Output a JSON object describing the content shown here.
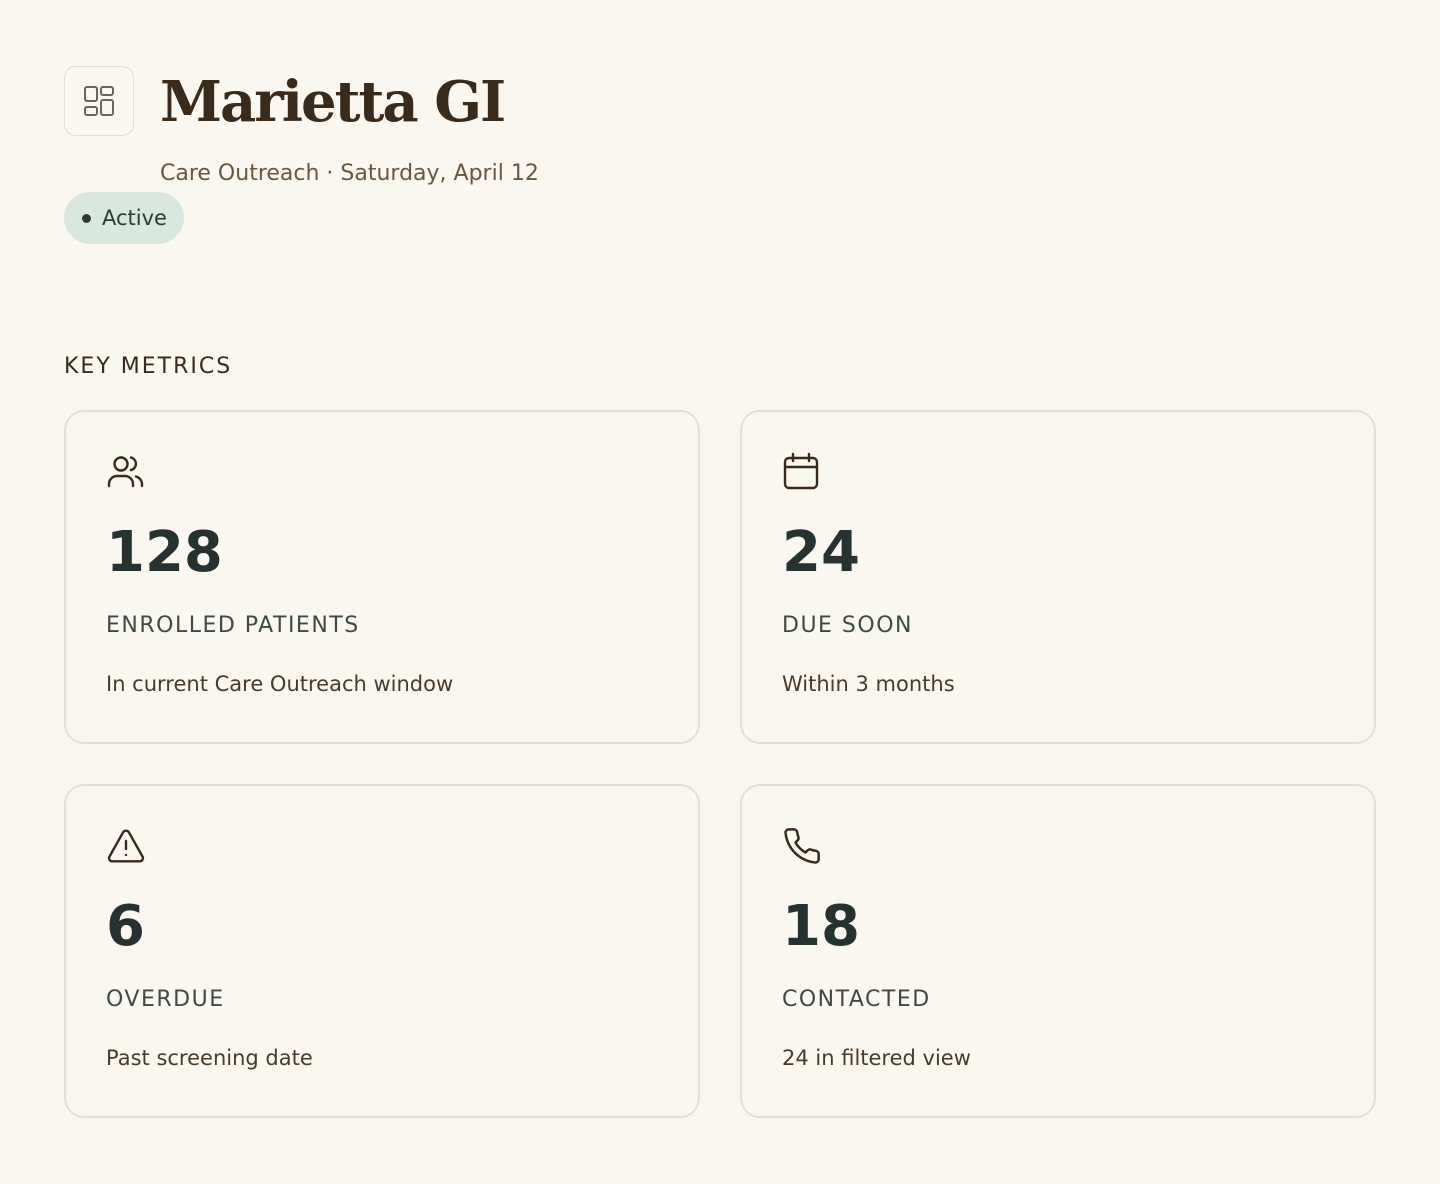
{
  "header": {
    "app_icon": "dashboard-grid-icon",
    "title": "Marietta GI",
    "subtitle": "Care Outreach · Saturday, April 12",
    "status": "Active"
  },
  "metrics_section": {
    "heading": "KEY METRICS",
    "cards": [
      {
        "icon": "users-icon",
        "value": "128",
        "label": "ENROLLED PATIENTS",
        "description": "In current Care Outreach window"
      },
      {
        "icon": "calendar-icon",
        "value": "24",
        "label": "DUE SOON",
        "description": "Within 3 months"
      },
      {
        "icon": "warning-triangle-icon",
        "value": "6",
        "label": "OVERDUE",
        "description": "Past screening date"
      },
      {
        "icon": "phone-icon",
        "value": "18",
        "label": "CONTACTED",
        "description": "24 in filtered view"
      }
    ]
  },
  "colors": {
    "background": "#faf7f1",
    "title_text": "#3a2a1a",
    "value_text": "#263230",
    "card_border": "#e4e0d8",
    "status_badge_bg": "#d8e7e0",
    "icon_stroke": "#3a2a1c"
  }
}
